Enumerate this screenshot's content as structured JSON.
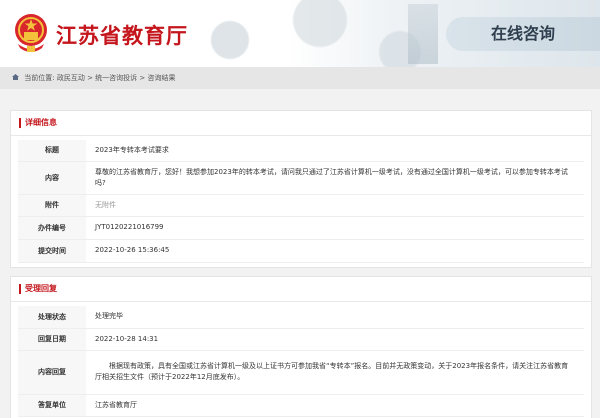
{
  "header": {
    "site_title": "江苏省教育厅",
    "section_tab": "在线咨询"
  },
  "breadcrumb": {
    "current_label": "当前位置:",
    "items": [
      "政民互动",
      "统一咨询投诉",
      "咨询结果"
    ],
    "separator": " > "
  },
  "detail": {
    "section_title": "详细信息",
    "rows": [
      {
        "label": "标题",
        "value": "2023年专转本考试要求"
      },
      {
        "label": "内容",
        "value": "尊敬的江苏省教育厅，您好！我想参加2023年的转本考试，请问我只通过了江苏省计算机一级考试，没有通过全国计算机一级考试，可以参加专转本考试吗?"
      },
      {
        "label": "附件",
        "value": "无附件"
      },
      {
        "label": "办件编号",
        "value": "JYT0120221016799"
      },
      {
        "label": "提交时间",
        "value": "2022-10-26 15:36:45"
      }
    ]
  },
  "reply": {
    "section_title": "受理回复",
    "rows": [
      {
        "label": "处理状态",
        "value": "处理完毕"
      },
      {
        "label": "回复日期",
        "value": "2022-10-28 14:31"
      },
      {
        "label": "内容回复",
        "value": "根据现有政策，具有全国或江苏省计算机一级及以上证书方可参加我省“专转本”报名。目前并无政策变动，关于2023年报名条件，请关注江苏省教育厅相关招生文件（预计于2022年12月底发布）。"
      },
      {
        "label": "答复单位",
        "value": "江苏省教育厅"
      }
    ]
  },
  "colors": {
    "brand_red": "#c4161c",
    "tab_text": "#2f3f4f"
  }
}
